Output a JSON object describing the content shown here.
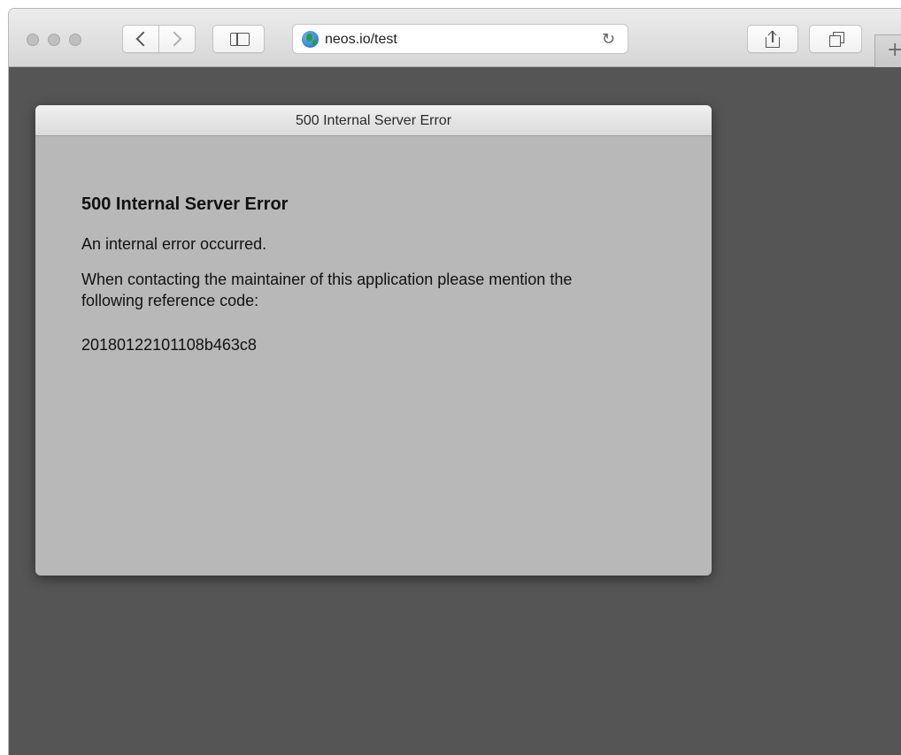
{
  "browser": {
    "url": "neos.io/test",
    "controls": {
      "close": "close-button",
      "minimize": "minimize-button",
      "zoom": "zoom-button"
    },
    "new_tab_label": "+",
    "reload_glyph": "↻"
  },
  "error": {
    "window_title": "500 Internal Server Error",
    "heading": "500 Internal Server Error",
    "message": "An internal error occurred.",
    "detail": "When contacting the maintainer of this application please mention the following reference code:",
    "reference_code": "20180122101108b463c8"
  },
  "colors": {
    "page_background": "#555555",
    "panel_background": "#b8b8b8",
    "toolbar": "#e0e0e0"
  },
  "icons": [
    "back-chevron-icon",
    "forward-chevron-icon",
    "sidebar-icon",
    "globe-icon",
    "reload-icon",
    "share-icon",
    "tabs-icon",
    "plus-icon"
  ]
}
